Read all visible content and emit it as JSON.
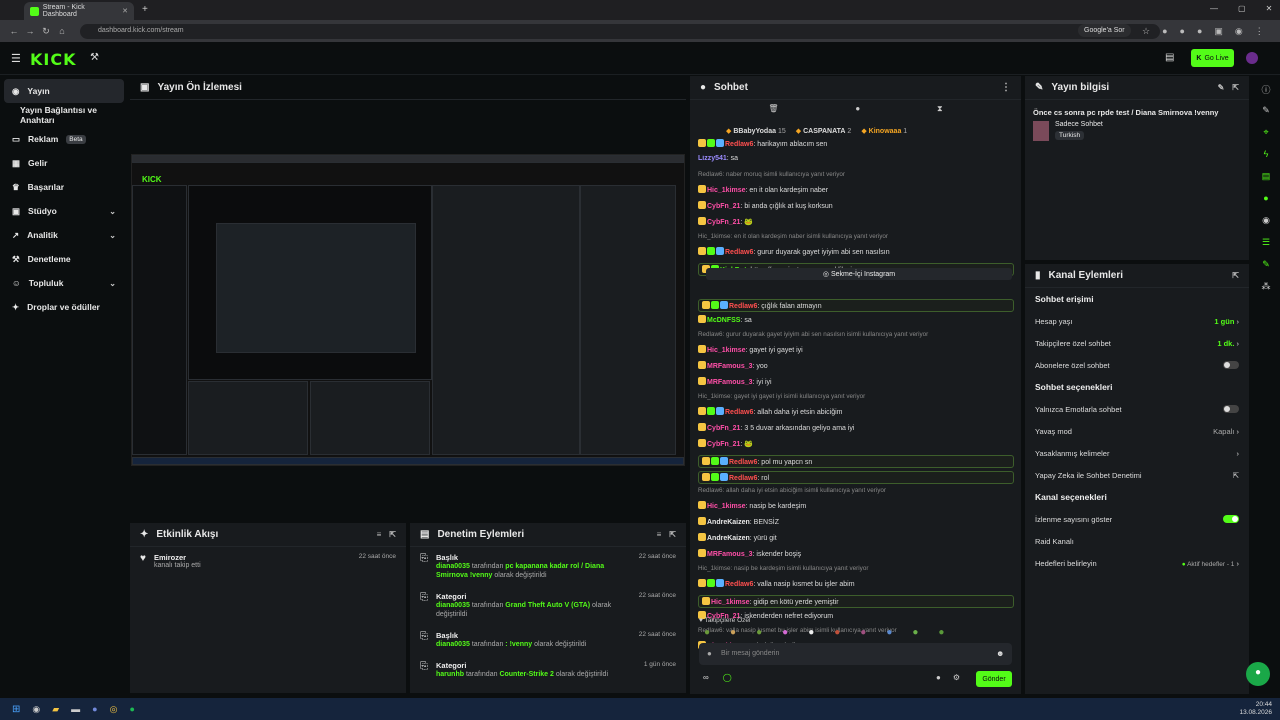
{
  "browser": {
    "tab_title": "Stream - Kick Dashboard",
    "url": "dashboard.kick.com/stream",
    "google_btn": "Google'a Sor"
  },
  "header": {
    "logo": "KICK",
    "go_live": "Go Live"
  },
  "sidebar": {
    "items": [
      {
        "label": "Yayın"
      },
      {
        "label": "Yayın Bağlantısı ve Anahtarı"
      },
      {
        "label": "Reklam",
        "badge": "Beta"
      },
      {
        "label": "Gelir"
      },
      {
        "label": "Başarılar"
      },
      {
        "label": "Stüdyo"
      },
      {
        "label": "Analitik"
      },
      {
        "label": "Denetleme"
      },
      {
        "label": "Topluluk"
      },
      {
        "label": "Droplar ve ödüller"
      }
    ]
  },
  "preview": {
    "title": "Yayın Ön İzlemesi"
  },
  "activity": {
    "title": "Etkinlik Akışı",
    "events": [
      {
        "name": "Emirozer",
        "desc": "kanalı takip etti",
        "time": "22 saat önce"
      }
    ]
  },
  "mod": {
    "title": "Denetim Eylemleri",
    "events": [
      {
        "type": "Başlık",
        "user": "diana0035",
        "by": "tarafından",
        "value": "pc kapanana kadar rol / Diana Smirnova !venny",
        "suffix": "olarak değiştirildi",
        "time": "22 saat önce"
      },
      {
        "type": "Kategori",
        "user": "diana0035",
        "by": "tarafından",
        "value": "Grand Theft Auto V (GTA)",
        "suffix": "olarak değiştirildi",
        "time": "22 saat önce"
      },
      {
        "type": "Başlık",
        "user": "diana0035",
        "by": "tarafından",
        "value": ": !venny",
        "suffix": "olarak değiştirildi",
        "time": "22 saat önce"
      },
      {
        "type": "Kategori",
        "user": "harunhb",
        "by": "tarafından",
        "value": "Counter-Strike 2",
        "suffix": "olarak değiştirildi",
        "time": "1 gün önce"
      }
    ]
  },
  "chat": {
    "title": "Sohbet",
    "leaders": [
      {
        "name": "BBabyYodaa",
        "count": "15"
      },
      {
        "name": "CASPANATA",
        "count": "2"
      },
      {
        "name": "Kinowaaa",
        "count": "1"
      }
    ],
    "messages": [
      {
        "user": "Redlaw6",
        "text": ": harikayım ablacım sen",
        "color": "#ff4f4f",
        "badges": 3
      },
      {
        "user": "Lizzy541",
        "text": ": sa",
        "color": "#9b8cff",
        "badges": 0
      },
      {
        "reply": "Redlaw6: naber moruq isimli kullanıcıya yanıt veriyor"
      },
      {
        "user": "Hic_1kimse",
        "text": ": en it olan kardeşim naber",
        "color": "#ff4fa8",
        "badges": 1
      },
      {
        "user": "CybFn_21",
        "text": ": bi anda çığlık at kuş korksun",
        "color": "#ff4fa8",
        "badges": 1
      },
      {
        "user": "CybFn_21",
        "text": ": 🐸",
        "color": "#ff4fa8",
        "badges": 1
      },
      {
        "reply": "Hic_1kimse: en it olan kardeşim naber isimli kullanıcıya yanıt veriyor"
      },
      {
        "user": "Redlaw6",
        "text": ": gurur duyarak gayet iyiyim abi sen nasılsın",
        "color": "#ff4f4f",
        "badges": 3
      },
      {
        "user": "KickBot",
        "text": ": https://www.instagram.com/dilosinn",
        "color": "#53fc18",
        "badges": 2,
        "highlight": true
      },
      {
        "user": "Redlaw6",
        "text": ": çığlık falan atmayın",
        "color": "#ff4f4f",
        "badges": 3,
        "highlight": true
      },
      {
        "user": "McDNFSS",
        "text": ": sa",
        "color": "#53fc18",
        "badges": 1
      },
      {
        "reply": "Redlaw6: gurur duyarak gayet iyiyim abi sen nasılsın isimli kullanıcıya yanıt veriyor"
      },
      {
        "user": "Hic_1kimse",
        "text": ": gayet iyi gayet iyi",
        "color": "#ff4fa8",
        "badges": 1
      },
      {
        "user": "MRFamous_3",
        "text": ": yoo",
        "color": "#ff4fa8",
        "badges": 1
      },
      {
        "user": "MRFamous_3",
        "text": ": iyi iyi",
        "color": "#ff4fa8",
        "badges": 1
      },
      {
        "reply": "Hic_1kimse: gayet iyi gayet iyi isimli kullanıcıya yanıt veriyor"
      },
      {
        "user": "Redlaw6",
        "text": ": allah daha iyi etsin abiciğim",
        "color": "#ff4f4f",
        "badges": 3
      },
      {
        "user": "CybFn_21",
        "text": ": 3 5 duvar arkasından geliyo ama iyi",
        "color": "#ff4fa8",
        "badges": 1
      },
      {
        "user": "CybFn_21",
        "text": ": 🐸",
        "color": "#ff4fa8",
        "badges": 1
      },
      {
        "user": "Redlaw6",
        "text": ": pol mu yapcn sn",
        "color": "#ff4f4f",
        "badges": 3,
        "highlight": true
      },
      {
        "user": "Redlaw6",
        "text": ": rol",
        "color": "#ff4f4f",
        "badges": 3,
        "highlight": true
      },
      {
        "reply": "Redlaw6: allah daha iyi etsin abiciğim isimli kullanıcıya yanıt veriyor"
      },
      {
        "user": "Hic_1kimse",
        "text": ": nasip be kardeşim",
        "color": "#ff4fa8",
        "badges": 1
      },
      {
        "user": "AndreKaizen",
        "text": ": BENSİZ",
        "color": "#e8e8e8",
        "badges": 1
      },
      {
        "user": "AndreKaizen",
        "text": ": yürü git",
        "color": "#e8e8e8",
        "badges": 1
      },
      {
        "user": "MRFamous_3",
        "text": ": iskender boşiş",
        "color": "#ff4fa8",
        "badges": 1
      },
      {
        "reply": "Hic_1kimse: nasip be kardeşim isimli kullanıcıya yanıt veriyor"
      },
      {
        "user": "Redlaw6",
        "text": ": valla nasip kısmet bu işler abim",
        "color": "#ff4f4f",
        "badges": 3
      },
      {
        "user": "Hic_1kimse",
        "text": ": gidip en kötü yerde yemiştir",
        "color": "#ff4fa8",
        "badges": 1,
        "highlight": true
      },
      {
        "user": "CybFn_21",
        "text": ": iskenderden nefret ediyorum",
        "color": "#ff4fa8",
        "badges": 1
      },
      {
        "reply": "Redlaw6: valla nasip kısmet bu işler abim isimli kullanıcıya yanıt veriyor"
      },
      {
        "user": "Hic_1kimse",
        "text": ": çok doğru dedin",
        "color": "#ff4fa8",
        "badges": 1
      }
    ],
    "instagram_btn": "Sekme-İçi Instagram",
    "followers_only": "Takipçilere Özel",
    "input_placeholder": "Bir mesaj gönderin",
    "send": "Gönder"
  },
  "info": {
    "title": "Yayın bilgisi",
    "stream_title": "Önce cs sonra pc rpde test / Diana Smirnova !venny",
    "category": "Sadece Sohbet",
    "language": "Turkish"
  },
  "actions": {
    "title": "Kanal Eylemleri",
    "chat_access": "Sohbet erişimi",
    "account_age": "Hesap yaşı",
    "account_age_val": "1 gün",
    "followers_chat": "Takipçilere özel sohbet",
    "followers_chat_val": "1 dk.",
    "subs_chat": "Abonelere özel sohbet",
    "chat_options": "Sohbet seçenekleri",
    "emote_only": "Yalnızca Emotlarla sohbet",
    "slow_mode": "Yavaş mod",
    "slow_mode_val": "Kapalı",
    "banned_words": "Yasaklanmış kelimeler",
    "ai_mod": "Yapay Zeka ile Sohbet Denetimi",
    "channel_options": "Kanal seçenekleri",
    "show_views": "İzlenme sayısını göster",
    "raid": "Raid Kanalı",
    "targets": "Hedefleri belirleyin",
    "targets_val": "Aktif hedefler - 1"
  },
  "taskbar": {
    "time": "20:44",
    "date": "13.08.2026"
  },
  "colors": {
    "accent": "#53fc18",
    "bg": "#0b0e0f",
    "panel": "#181b1e"
  }
}
